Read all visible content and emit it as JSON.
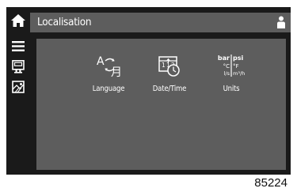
{
  "header": {
    "title": "Localisation",
    "home_icon": "home-icon",
    "user_icon": "user-icon"
  },
  "sidebar": {
    "items": [
      {
        "icon": "menu-icon"
      },
      {
        "icon": "controller-icon"
      },
      {
        "icon": "map-icon"
      }
    ]
  },
  "tiles": [
    {
      "label": "Language",
      "icon": "language-icon"
    },
    {
      "label": "Date/Time",
      "icon": "date-time-icon"
    },
    {
      "label": "Units",
      "icon": "units-icon",
      "icon_text": {
        "bar": "bar",
        "psi": "psi",
        "c": "°C",
        "f": "°F",
        "ls": "l/s",
        "m3h": "m³/h"
      }
    }
  ],
  "figure_number": "85224",
  "colors": {
    "screen_bg": "#1a1a1a",
    "panel_bg": "#5d5d5d",
    "text": "#ffffff"
  }
}
